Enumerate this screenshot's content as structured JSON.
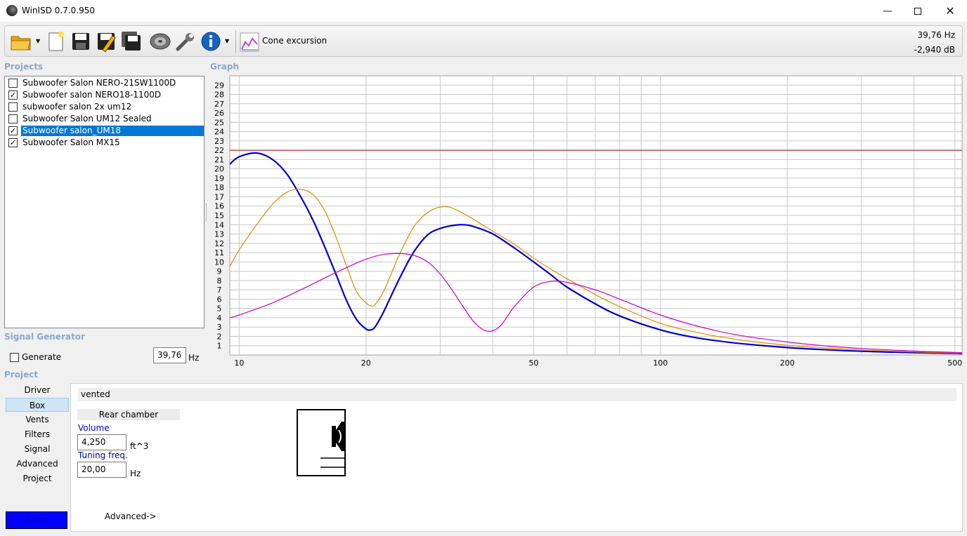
{
  "window": {
    "title": "WinISD 0.7.0.950"
  },
  "toolbar": {
    "cone_label": "Cone excursion",
    "readout_freq": "39,76 Hz",
    "readout_db": "-2,940 dB"
  },
  "projects": {
    "label": "Projects",
    "items": [
      {
        "name": "Subwoofer Salon NERO-21SW1100D",
        "checked": false,
        "selected": false
      },
      {
        "name": "Subwoofer salon NERO18-1100D",
        "checked": true,
        "selected": false
      },
      {
        "name": "subwoofer salon 2x um12",
        "checked": false,
        "selected": false
      },
      {
        "name": "Subwoofer Salon UM12 Sealed",
        "checked": false,
        "selected": false
      },
      {
        "name": "Subwoofer salon_UM18",
        "checked": true,
        "selected": true
      },
      {
        "name": "Subwoofer Salon MX15",
        "checked": true,
        "selected": false
      }
    ]
  },
  "signal_generator": {
    "label": "Signal Generator",
    "generate_label": "Generate",
    "generate_checked": false,
    "frequency": "39,76",
    "unit": "Hz"
  },
  "graph": {
    "label": "Graph"
  },
  "chart_data": {
    "type": "line",
    "title": "",
    "xlabel": "",
    "ylabel": "",
    "x_scale": "log",
    "xlim": [
      9.5,
      520
    ],
    "ylim": [
      0,
      30
    ],
    "x_tick_labels": [
      "10",
      "20",
      "50",
      "100",
      "200",
      "500"
    ],
    "x_tick_values": [
      10,
      20,
      50,
      100,
      200,
      500
    ],
    "y_tick_labels": [
      "1",
      "2",
      "3",
      "4",
      "5",
      "6",
      "7",
      "8",
      "9",
      "10",
      "11",
      "12",
      "13",
      "14",
      "15",
      "16",
      "17",
      "18",
      "19",
      "20",
      "21",
      "22",
      "23",
      "24",
      "25",
      "26",
      "27",
      "28",
      "29"
    ],
    "grid": true,
    "limit_line": {
      "y": 22,
      "color": "#c00000"
    },
    "series": [
      {
        "color": "#0000cc",
        "x": [
          9.5,
          10,
          11,
          12,
          13,
          14,
          15,
          16,
          17,
          18,
          19,
          20,
          20.5,
          21,
          22,
          24,
          26,
          28,
          30,
          32,
          34,
          36,
          40,
          45,
          50,
          55,
          60,
          70,
          80,
          100,
          120,
          150,
          200,
          250,
          300,
          400,
          500,
          520
        ],
        "y": [
          20.5,
          21.3,
          21.7,
          21.0,
          19.4,
          17.0,
          14.4,
          11.5,
          8.6,
          5.8,
          3.8,
          2.8,
          2.7,
          3.0,
          4.6,
          8.2,
          11.1,
          12.9,
          13.6,
          13.9,
          14.0,
          13.8,
          13.0,
          11.5,
          10.0,
          8.6,
          7.3,
          5.5,
          4.2,
          2.7,
          1.9,
          1.3,
          0.8,
          0.55,
          0.4,
          0.25,
          0.17,
          0.15
        ]
      },
      {
        "color": "#e08a00",
        "x": [
          9.5,
          10,
          11,
          12,
          13,
          14,
          15,
          16,
          17,
          18,
          19,
          20,
          20.5,
          21,
          22,
          23,
          24,
          26,
          28,
          30,
          32,
          35,
          40,
          45,
          50,
          55,
          60,
          70,
          80,
          100,
          120,
          150,
          200,
          250,
          300,
          400,
          500,
          520
        ],
        "y": [
          9.5,
          11.3,
          14.0,
          16.2,
          17.5,
          17.8,
          17.2,
          15.4,
          12.6,
          9.5,
          6.8,
          5.6,
          5.3,
          5.4,
          6.8,
          8.8,
          10.8,
          13.8,
          15.3,
          15.9,
          15.8,
          14.9,
          13.3,
          11.9,
          10.4,
          9.2,
          8.2,
          6.5,
          5.2,
          3.4,
          2.5,
          1.7,
          1.05,
          0.75,
          0.55,
          0.33,
          0.22,
          0.2
        ]
      },
      {
        "color": "#cc00cc",
        "x": [
          9.5,
          10,
          12,
          14,
          16,
          18,
          20,
          22,
          24,
          26,
          28,
          30,
          32,
          34,
          36,
          38,
          40,
          42,
          45,
          50,
          55,
          60,
          70,
          80,
          100,
          120,
          150,
          200,
          250,
          300,
          400,
          500,
          520
        ],
        "y": [
          4.0,
          4.3,
          5.6,
          7.0,
          8.3,
          9.4,
          10.3,
          10.8,
          10.9,
          10.7,
          10.0,
          8.7,
          7.0,
          5.2,
          3.6,
          2.7,
          2.6,
          3.3,
          5.2,
          7.3,
          7.9,
          7.8,
          7.0,
          6.0,
          4.3,
          3.2,
          2.2,
          1.4,
          0.95,
          0.7,
          0.42,
          0.28,
          0.26
        ]
      }
    ]
  },
  "project_section": {
    "label": "Project",
    "nav": [
      "Driver",
      "Box",
      "Vents",
      "Filters",
      "Signal",
      "Advanced",
      "Project"
    ],
    "active_nav": "Box",
    "color_button": "Color"
  },
  "box_panel": {
    "type": "vented",
    "rear_chamber": "Rear chamber",
    "volume_label": "Volume",
    "volume_value": "4,250",
    "volume_unit": "ft^3",
    "tuning_label": "Tuning freq.",
    "tuning_value": "20,00",
    "tuning_unit": "Hz",
    "advanced_link": "Advanced->"
  }
}
